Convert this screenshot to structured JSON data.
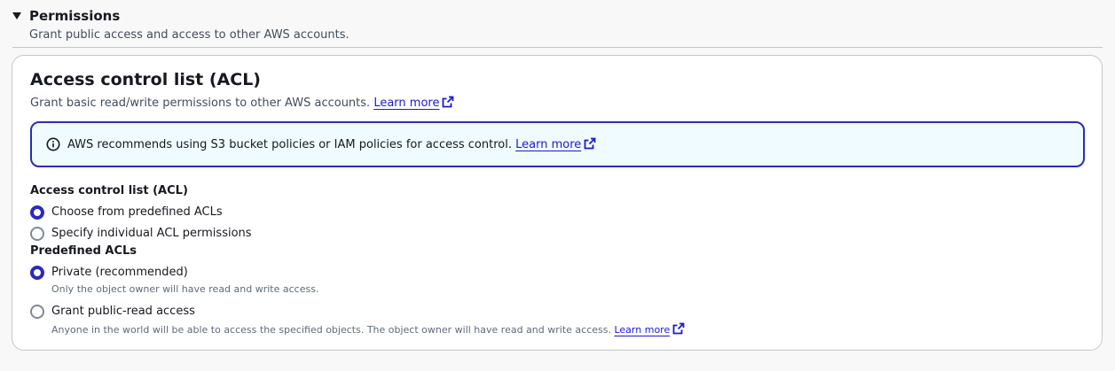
{
  "permissions": {
    "title": "Permissions",
    "description": "Grant public access and access to other AWS accounts."
  },
  "acl": {
    "title": "Access control list (ACL)",
    "description": "Grant basic read/write permissions to other AWS accounts.",
    "learn_more": "Learn more"
  },
  "alert": {
    "text": "AWS recommends using S3 bucket policies or IAM policies for access control.",
    "learn_more": "Learn more"
  },
  "acl_field": {
    "label": "Access control list (ACL)",
    "options": [
      {
        "label": "Choose from predefined ACLs",
        "selected": true
      },
      {
        "label": "Specify individual ACL permissions",
        "selected": false
      }
    ]
  },
  "predefined": {
    "label": "Predefined ACLs",
    "options": [
      {
        "label": "Private (recommended)",
        "description": "Only the object owner will have read and write access.",
        "selected": true
      },
      {
        "label": "Grant public-read access",
        "description": "Anyone in the world will be able to access the specified objects. The object owner will have read and write access.",
        "learn_more": "Learn more",
        "selected": false
      }
    ]
  },
  "icons": {
    "expand": "caret-down-icon",
    "external": "external-link-icon",
    "info": "info-icon"
  },
  "colors": {
    "accent": "#2b2bb8",
    "link": "#1a1ad6",
    "alert_bg": "#f0fbff"
  }
}
